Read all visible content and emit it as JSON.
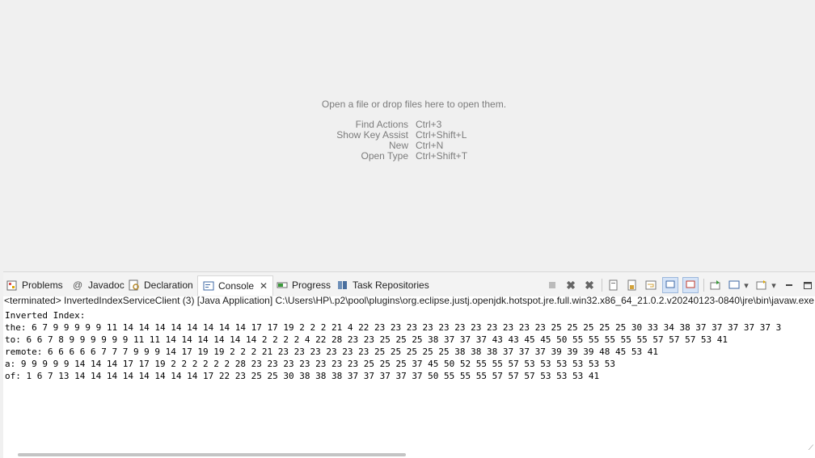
{
  "editor": {
    "open_hint": "Open a file or drop files here to open them.",
    "shortcuts": [
      {
        "name": "Find Actions",
        "key": "Ctrl+3"
      },
      {
        "name": "Show Key Assist",
        "key": "Ctrl+Shift+L"
      },
      {
        "name": "New",
        "key": "Ctrl+N"
      },
      {
        "name": "Open Type",
        "key": "Ctrl+Shift+T"
      }
    ]
  },
  "tabs": [
    {
      "label": "Problems",
      "icon": "problems-icon"
    },
    {
      "label": "Javadoc",
      "icon": "at-icon"
    },
    {
      "label": "Declaration",
      "icon": "declaration-icon"
    },
    {
      "label": "Console",
      "icon": "console-icon",
      "active": true
    },
    {
      "label": "Progress",
      "icon": "progress-icon"
    },
    {
      "label": "Task Repositories",
      "icon": "task-repositories-icon"
    }
  ],
  "console": {
    "launch": "<terminated> InvertedIndexServiceClient (3) [Java Application] C:\\Users\\HP\\.p2\\pool\\plugins\\org.eclipse.justj.openjdk.hotspot.jre.full.win32.x86_64_21.0.2.v20240123-0840\\jre\\bin\\javaw.exe  (",
    "lines": [
      "Inverted Index:",
      "the: 6 7 9 9 9 9 9 11 14 14 14 14 14 14 14 14 17 17 19 2 2 2 21 4 22 23 23 23 23 23 23 23 23 23 23 23 25 25 25 25 25 30 33 34 38 37 37 37 37 37 3",
      "to: 6 6 7 8 9 9 9 9 9 9 11 11 14 14 14 14 14 14 2 2 2 2 4 22 28 23 23 25 25 25 38 37 37 37 43 43 45 45 50 55 55 55 55 55 57 57 57 53 41",
      "remote: 6 6 6 6 6 7 7 7 9 9 9 14 17 19 19 2 2 2 21 23 23 23 23 23 23 25 25 25 25 25 38 38 38 37 37 37 39 39 39 48 45 53 41",
      "a: 9 9 9 9 9 14 14 14 17 17 19 2 2 2 2 2 2 28 23 23 23 23 23 23 23 25 25 25 37 45 50 52 55 55 57 53 53 53 53 53 53",
      "of: 1 6 7 13 14 14 14 14 14 14 14 14 17 22 23 25 25 30 38 38 38 37 37 37 37 37 50 55 55 55 57 57 57 53 53 53 41"
    ]
  },
  "colors": {
    "accent": "#1f6fd1",
    "background": "#f0f0f0"
  }
}
